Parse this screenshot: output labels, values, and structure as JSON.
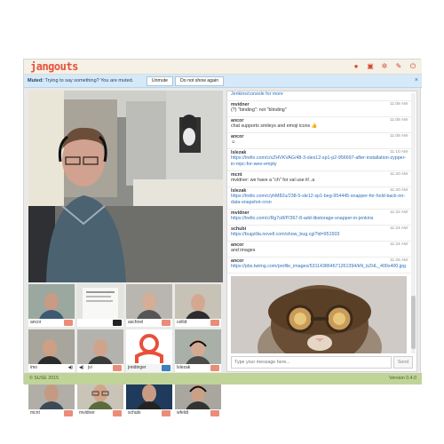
{
  "app": {
    "brand": "jangouts",
    "header_icons": [
      "record-icon",
      "screen-share-icon",
      "settings-icon",
      "pin-icon",
      "logout-icon"
    ]
  },
  "muted_bar": {
    "label": "Muted:",
    "message": "Trying to say something? You are muted.",
    "unmute_label": "Unmute",
    "dont_show_label": "Do not show again",
    "close_label": "×"
  },
  "participants": [
    {
      "name": "ancor",
      "indicator": "red"
    },
    {
      "name": "",
      "indicator": "dark"
    },
    {
      "name": "aschnel",
      "indicator": "red"
    },
    {
      "name": "cellid",
      "indicator": "red"
    },
    {
      "name": "imo",
      "indicator": "none"
    },
    {
      "name": "jvi",
      "indicator": "red"
    },
    {
      "name": "jreidinger",
      "indicator": "blue"
    },
    {
      "name": "lslezak",
      "indicator": "red"
    },
    {
      "name": "mcnt",
      "indicator": "red"
    },
    {
      "name": "mvidner",
      "indicator": "red"
    },
    {
      "name": "schubi",
      "indicator": "red"
    },
    {
      "name": "wfeldt",
      "indicator": "red"
    }
  ],
  "chat": {
    "top_partial": "Jenkins/console for more",
    "messages": [
      {
        "user": "mvidner",
        "time": "11:08 AM",
        "text": "(?) \"binding\": not \"blinding\""
      },
      {
        "user": "ancor",
        "time": "11:08 AM",
        "text": "chat supports smileys and emoji icons 👍"
      },
      {
        "user": "ancor",
        "time": "11:08 AM",
        "text": "☺"
      },
      {
        "user": "lslezak",
        "time": "11:10 AM",
        "text": "https://trello.com/c/xZHVKVAG/48-3-sles12-sp1-p2-956697-after-installation-zypper-in-mpc-for-wee-empty",
        "link": true
      },
      {
        "user": "mcnt",
        "time": "11:20 AM",
        "text": "mvidner: we have a \"ch\" for val use it!..a"
      },
      {
        "user": "lslezak",
        "time": "11:20 AM",
        "text": "https://trello.com/c/yhM82u/238-5-sle12-sp1-beg-954445-snapper-for-hold-back-on-data-snapshot-cron",
        "link": true
      },
      {
        "user": "mvidner",
        "time": "11:22 AM",
        "text": "https://trello.com/c/Rg7o8/P/367-8-add-libstorage-snapper-in-jenkins",
        "link": true
      },
      {
        "user": "schubi",
        "time": "11:24 AM",
        "text": "https://bugzilla.novell.com/show_bug.cgi?id=951503",
        "link": true
      },
      {
        "user": "ancor",
        "time": "11:24 AM",
        "text": "and images"
      },
      {
        "user": "ancor",
        "time": "11:25 AM",
        "text": "https://pbs.twimg.com/profile_images/531143864671261394/kN_bZHL_400x400.jpg",
        "link": true
      }
    ],
    "input_placeholder": "Type your message here...",
    "send_label": "Send"
  },
  "footer": {
    "copyright": "© SUSE 2015",
    "version": "Version 0.4.0"
  },
  "colors": {
    "brand": "#e8503a",
    "muted_bar": "#d5e9f8",
    "footer": "#c0d49a",
    "link": "#2a6fb8"
  }
}
